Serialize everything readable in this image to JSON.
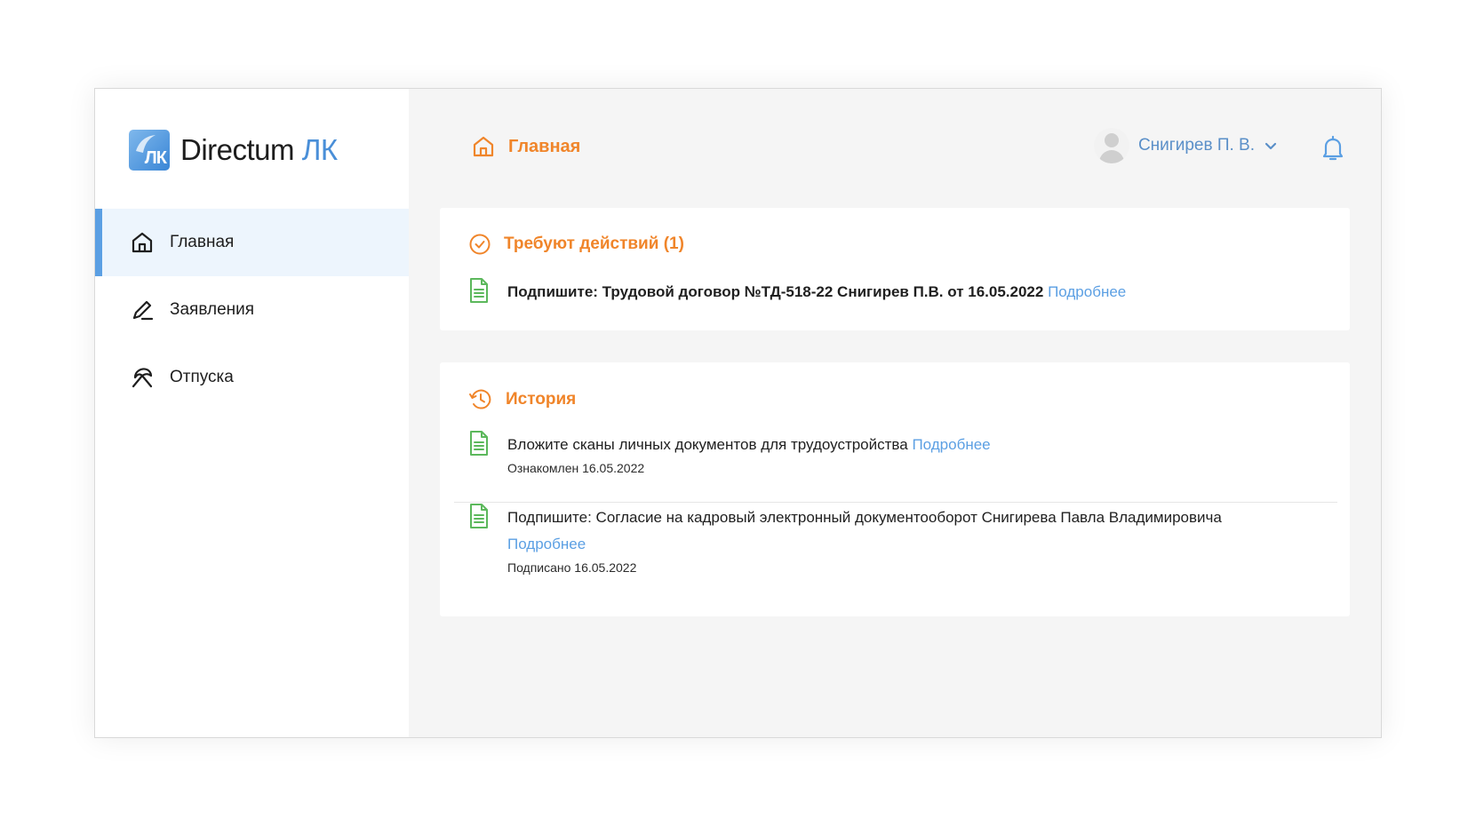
{
  "app": {
    "brand_name": "Directum",
    "brand_accent": "ЛК",
    "logo_mark_text": "ЛК"
  },
  "sidebar": {
    "items": [
      {
        "label": "Главная",
        "icon": "home-icon",
        "active": true
      },
      {
        "label": "Заявления",
        "icon": "pen-icon",
        "active": false
      },
      {
        "label": "Отпуска",
        "icon": "umbrella-icon",
        "active": false
      }
    ]
  },
  "header": {
    "title": "Главная",
    "user_name": "Снигирев П. В."
  },
  "actions": {
    "title": "Требуют действий (1)",
    "items": [
      {
        "text": "Подпишите: Трудовой договор №ТД-518-22 Снигирев П.В. от 16.05.2022",
        "link": "Подробнее"
      }
    ]
  },
  "history": {
    "title": "История",
    "items": [
      {
        "text": "Вложите сканы личных документов для трудоустройства",
        "link": "Подробнее",
        "status": "Ознакомлен 16.05.2022"
      },
      {
        "text": "Подпишите: Согласие на кадровый электронный документооборот Снигирева Павла Владимировича",
        "link": "Подробнее",
        "status": "Подписано 16.05.2022"
      }
    ]
  },
  "colors": {
    "accent_orange": "#f0852a",
    "link_blue": "#5b9fe3",
    "doc_green": "#5cb85c",
    "active_nav_bg": "#edf5fd"
  }
}
